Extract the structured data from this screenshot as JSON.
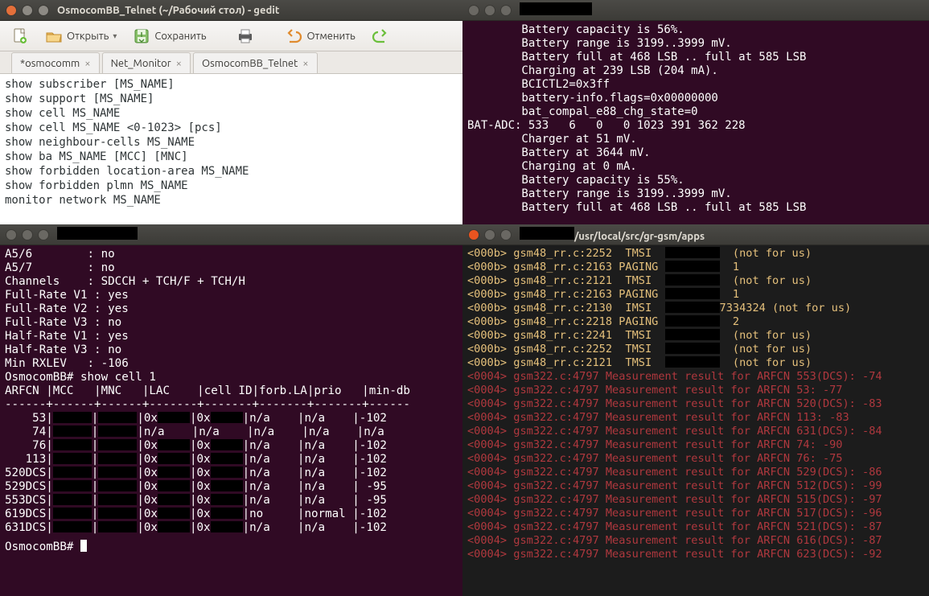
{
  "gedit": {
    "window_title": "OsmocomBB_Telnet (~/Рабочий стол) - gedit",
    "toolbar": {
      "open_label": "Открыть",
      "save_label": "Сохранить",
      "undo_label": "Отменить"
    },
    "tabs": [
      {
        "label": "*osmocomm"
      },
      {
        "label": "Net_Monitor"
      },
      {
        "label": "OsmocomBB_Telnet"
      }
    ],
    "lines": [
      "show subscriber [MS_NAME]",
      "show support [MS_NAME]",
      "show cell MS_NAME",
      "show cell MS_NAME <0-1023> [pcs]",
      "show neighbour-cells MS_NAME",
      "show ba MS_NAME [MCC] [MNC]",
      "show forbidden location-area MS_NAME",
      "show forbidden plmn MS_NAME",
      "monitor network MS_NAME"
    ]
  },
  "term_tr": {
    "lines": [
      "        Battery capacity is 56%.",
      "        Battery range is 3199..3999 mV.",
      "        Battery full at 468 LSB .. full at 585 LSB",
      "        Charging at 239 LSB (204 mA).",
      "        BCICTL2=0x3ff",
      "        battery-info.flags=0x00000000",
      "        bat_compal_e88_chg_state=0",
      "BAT-ADC: 533   6   0   0 1023 391 362 228",
      "        Charger at 51 mV.",
      "        Battery at 3644 mV.",
      "        Charging at 0 mA.",
      "        Battery capacity is 55%.",
      "        Battery range is 3199..3999 mV.",
      "        Battery full at 468 LSB .. full at 585 LSB"
    ]
  },
  "term_bl": {
    "lines": [
      "A5/6        : no",
      "A5/7        : no",
      "Channels    : SDCCH + TCH/F + TCH/H",
      "Full-Rate V1 : yes",
      "Full-Rate V2 : yes",
      "Full-Rate V3 : no",
      "Half-Rate V1 : yes",
      "Half-Rate V3 : no",
      "Min RXLEV   : -106",
      "",
      "OsmocomBB# show cell 1",
      "ARFCN |MCC   |MNC   |LAC    |cell ID|forb.LA|prio   |min-db",
      "------+------+------+-------+-------+-------+-------+------"
    ],
    "rows": [
      {
        "arfcn": "   53",
        "forb": "n/a",
        "prio": "n/a",
        "mindb": "-102"
      },
      {
        "arfcn": "   74",
        "lac": "n/a",
        "cell": "n/a",
        "forb": "n/a",
        "prio": "n/a",
        "mindb": "n/a"
      },
      {
        "arfcn": "   76",
        "forb": "n/a",
        "prio": "n/a",
        "mindb": "-102"
      },
      {
        "arfcn": "  113",
        "forb": "n/a",
        "prio": "n/a",
        "mindb": "-102"
      },
      {
        "arfcn": "520DCS",
        "forb": "n/a",
        "prio": "n/a",
        "mindb": "-102"
      },
      {
        "arfcn": "529DCS",
        "forb": "n/a",
        "prio": "n/a",
        "mindb": " -95"
      },
      {
        "arfcn": "553DCS",
        "forb": "n/a",
        "prio": "n/a",
        "mindb": " -95"
      },
      {
        "arfcn": "619DCS",
        "forb": "no",
        "prio": "normal",
        "mindb": "-102"
      },
      {
        "arfcn": "631DCS",
        "forb": "n/a",
        "prio": "n/a",
        "mindb": "-102"
      }
    ],
    "prompt": "OsmocomBB# "
  },
  "term_br": {
    "title_path": "/usr/local/src/gr-gsm/apps",
    "yellow_lines": [
      {
        "pre": "<000b> gsm48_rr.c:2252  TMSI  ",
        "post": "  (not for us)"
      },
      {
        "pre": "<000b> gsm48_rr.c:2163 PAGING ",
        "post": "  1"
      },
      {
        "pre": "<000b> gsm48_rr.c:2121  TMSI  ",
        "post": "  (not for us)"
      },
      {
        "pre": "<000b> gsm48_rr.c:2163 PAGING ",
        "post": "  1"
      },
      {
        "pre": "<000b> gsm48_rr.c:2130  IMSI  ",
        "post": "7334324 (not for us)"
      },
      {
        "pre": "<000b> gsm48_rr.c:2218 PAGING ",
        "post": "  2"
      },
      {
        "pre": "<000b> gsm48_rr.c:2241  TMSI  ",
        "post": "  (not for us)"
      },
      {
        "pre": "<000b> gsm48_rr.c:2252  TMSI  ",
        "post": "  (not for us)"
      },
      {
        "pre": "<000b> gsm48_rr.c:2121  TMSI  ",
        "post": "  (not for us)"
      }
    ],
    "red_lines": [
      "<0004> gsm322.c:4797 Measurement result for ARFCN 553(DCS): -74",
      "<0004> gsm322.c:4797 Measurement result for ARFCN 53: -77",
      "<0004> gsm322.c:4797 Measurement result for ARFCN 520(DCS): -83",
      "<0004> gsm322.c:4797 Measurement result for ARFCN 113: -83",
      "<0004> gsm322.c:4797 Measurement result for ARFCN 631(DCS): -84",
      "<0004> gsm322.c:4797 Measurement result for ARFCN 74: -90",
      "<0004> gsm322.c:4797 Measurement result for ARFCN 76: -75",
      "<0004> gsm322.c:4797 Measurement result for ARFCN 529(DCS): -86",
      "<0004> gsm322.c:4797 Measurement result for ARFCN 512(DCS): -99",
      "<0004> gsm322.c:4797 Measurement result for ARFCN 515(DCS): -97",
      "<0004> gsm322.c:4797 Measurement result for ARFCN 517(DCS): -96",
      "<0004> gsm322.c:4797 Measurement result for ARFCN 521(DCS): -87",
      "<0004> gsm322.c:4797 Measurement result for ARFCN 616(DCS): -87",
      "<0004> gsm322.c:4797 Measurement result for ARFCN 623(DCS): -92"
    ]
  }
}
